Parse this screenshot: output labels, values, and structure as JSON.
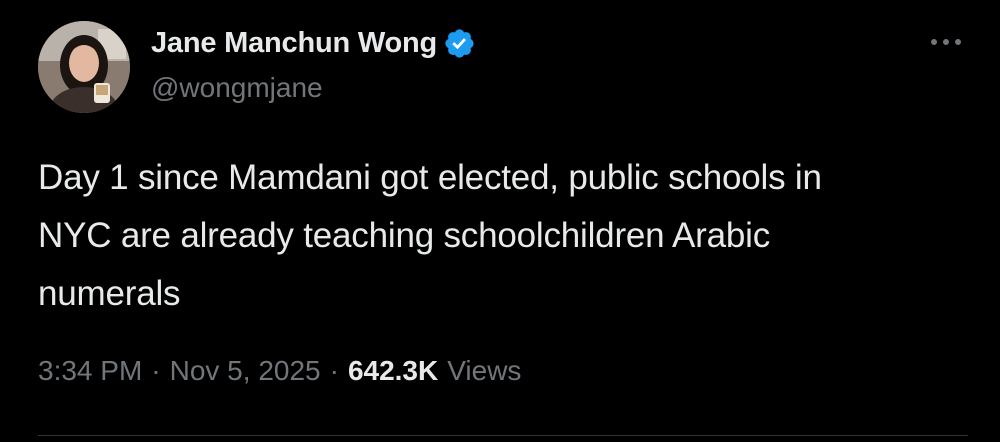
{
  "author": {
    "display_name": "Jane Manchun Wong",
    "handle": "@wongmjane",
    "verified": true,
    "verified_icon": "verified-badge-icon",
    "verified_color": "#1d9bf0"
  },
  "tweet": {
    "text": "Day 1 since Mamdani got elected, public schools in\nNYC are already teaching schoolchildren Arabic\nnumerals"
  },
  "meta": {
    "time": "3:34 PM",
    "separator": "·",
    "date": "Nov 5, 2025",
    "views_count": "642.3K",
    "views_label": "Views"
  },
  "menu": {
    "more_icon": "more-options-icon"
  },
  "colors": {
    "background": "#000000",
    "primary_text": "#e7e9ea",
    "secondary_text": "#71767b",
    "accent": "#1d9bf0"
  }
}
